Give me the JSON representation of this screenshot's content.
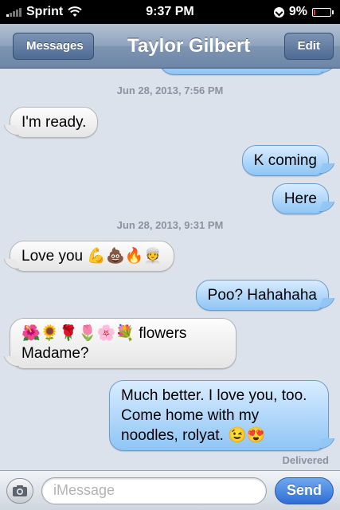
{
  "status_bar": {
    "carrier": "Sprint",
    "time": "9:37 PM",
    "battery_percent": "9%",
    "battery_level": 0.09,
    "signal_icon": "signal-bars-icon",
    "wifi_icon": "wifi-icon",
    "lock_icon": "rotation-lock-icon",
    "battery_color": "#e33333"
  },
  "nav": {
    "back_label": "Messages",
    "title": "Taylor Gilbert",
    "edit_label": "Edit"
  },
  "conversation": {
    "timestamp_1": "Jun 28, 2013, 7:56 PM",
    "msg_1": "I'm ready.",
    "msg_2": "K coming",
    "msg_3": "Here",
    "timestamp_2": "Jun 28, 2013, 9:31 PM",
    "msg_4_text": "Love you",
    "msg_4_emoji": "💪💩🔥👳",
    "msg_5": "Poo? Hahahaha",
    "msg_6_emoji": "🌺🌻🌹🌷🌸💐",
    "msg_6_text_a": "flowers",
    "msg_6_text_b": "Madame?",
    "msg_7_text": "Much better. I love you, too. Come home with my noodles, rolyat.",
    "msg_7_emoji": "😉😍",
    "delivered": "Delivered"
  },
  "input_bar": {
    "camera_icon": "camera-icon",
    "placeholder": "iMessage",
    "value": "",
    "send_label": "Send"
  },
  "colors": {
    "outgoing_bubble": "#8ec5f5",
    "incoming_bubble": "#e5e5e5",
    "background": "#dbe2ec",
    "send_button": "#2e6ed3"
  }
}
